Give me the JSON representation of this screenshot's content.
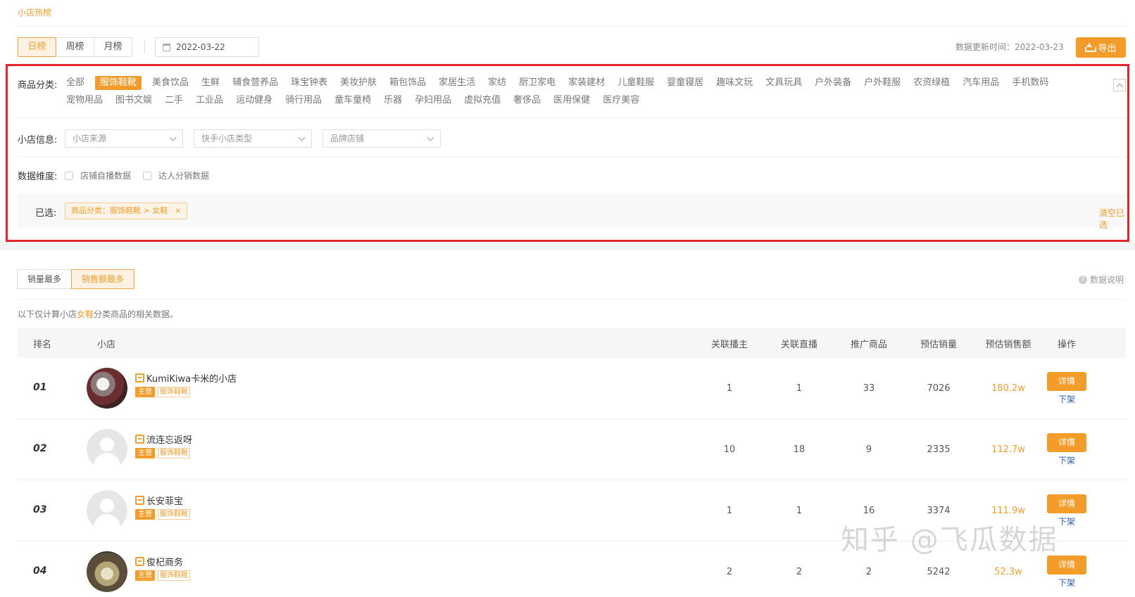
{
  "page_tab": "小店热榜",
  "rank_tabs": [
    "日榜",
    "周榜",
    "月榜"
  ],
  "date_value": "2022-03-22",
  "update_time": "数据更新时间：2022-03-23",
  "export_label": "导出",
  "filters": {
    "category_label": "商品分类:",
    "categories_row1": [
      "全部",
      "服饰鞋靴",
      "美食饮品",
      "生鲜",
      "辅食营养品",
      "珠宝钟表",
      "美妆护肤",
      "箱包饰品",
      "家居生活",
      "家纺",
      "厨卫家电",
      "家装建材",
      "儿童鞋服",
      "婴童寝居",
      "趣味文玩",
      "文具玩具",
      "户外装备",
      "户外鞋服",
      "农资绿植",
      "汽车用品",
      "手机数码"
    ],
    "categories_row2": [
      "宠物用品",
      "图书文娱",
      "二手",
      "工业品",
      "运动健身",
      "骑行用品",
      "童车童椅",
      "乐器",
      "孕妇用品",
      "虚拟充值",
      "奢侈品",
      "医用保健",
      "医疗美容"
    ],
    "active_category": "服饰鞋靴",
    "shop_info_label": "小店信息:",
    "selects": [
      "小店来源",
      "快手小店类型",
      "品牌店铺"
    ],
    "dimension_label": "数据维度:",
    "checkboxes": [
      "店铺自播数据",
      "达人分销数据"
    ],
    "selected_label": "已选:",
    "selected_tag": "商品分类：服饰鞋靴 > 女鞋",
    "tag_close": "×",
    "clear_label": "清空已选"
  },
  "sort_tabs": [
    "销量最多",
    "销售额最多"
  ],
  "data_note": "数据说明",
  "desc": {
    "pre": "以下仅计算小店",
    "hl": "女鞋",
    "post": "分类商品的相关数据。"
  },
  "table": {
    "headers": [
      "排名",
      "小店",
      "关联播主",
      "关联直播",
      "推广商品",
      "预估销量",
      "预估销售额",
      "操作"
    ],
    "rows": [
      {
        "rank": "01",
        "name": "KumiKiwa卡米的小店",
        "badge": "主营",
        "cat": "服饰鞋靴",
        "streamers": "1",
        "lives": "1",
        "products": "33",
        "sales": "7026",
        "revenue": "180.2w",
        "detail": "详情",
        "off": "下架"
      },
      {
        "rank": "02",
        "name": "流连忘返呀",
        "badge": "主营",
        "cat": "服饰鞋靴",
        "streamers": "10",
        "lives": "18",
        "products": "9",
        "sales": "2335",
        "revenue": "112.7w",
        "detail": "详情",
        "off": "下架"
      },
      {
        "rank": "03",
        "name": "长安菲宝",
        "badge": "主营",
        "cat": "服饰鞋靴",
        "streamers": "1",
        "lives": "1",
        "products": "16",
        "sales": "3374",
        "revenue": "111.9w",
        "detail": "详情",
        "off": "下架"
      },
      {
        "rank": "04",
        "name": "俊杞商务",
        "badge": "主营",
        "cat": "服饰鞋靴",
        "streamers": "2",
        "lives": "2",
        "products": "2",
        "sales": "5242",
        "revenue": "52.3w",
        "detail": "详情",
        "off": "下架"
      }
    ]
  },
  "watermark": "知乎 @飞瓜数据",
  "colors": {
    "accent": "#f39c29",
    "highlight_border": "#e4262b"
  }
}
